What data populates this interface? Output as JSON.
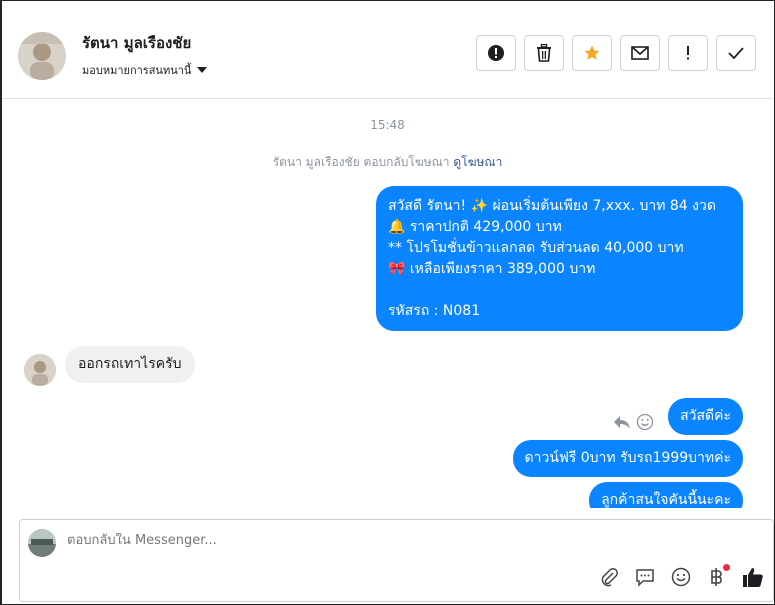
{
  "header": {
    "contact_name": "รัตนา มูลเรืองชัย",
    "assign_label": "มอบหมายการสนทนานี้",
    "actions": [
      "spam-icon",
      "trash-icon",
      "star-icon",
      "mail-icon",
      "exclamation-icon",
      "check-icon"
    ]
  },
  "thread": {
    "time": "15:48",
    "reply_note": "รัตนา มูลเรืองชัย ตอบกลับโฆษณา",
    "reply_note_link": "ดูโฆษณา",
    "promo": {
      "line1": "สวัสดี รัตนา! ✨  ผ่อนเริ่มต้นเพียง 7,xxx. บาท 84 งวด",
      "line2": "🔔 ราคาปกติ 429,000 บาท",
      "line3": "** โปรโมชั่นข้าวแลกลด รับส่วนลด 40,000 บาท",
      "line4": "🎀  เหลือเพียงราคา 389,000 บาท",
      "line5": " รหัสรถ : N081"
    },
    "incoming": "ออกรถเทาไรครับ",
    "outgoing": [
      "สวัสดีค่ะ",
      "ดาวน์ฟรี 0บาท รับรถ1999บาทค่ะ",
      "ลูกค้าสนใจคันนี้นะคะ"
    ]
  },
  "composer": {
    "placeholder": "ตอบกลับใน Messenger...",
    "tools": [
      "attach-icon",
      "saved-replies-icon",
      "emoji-icon",
      "baht-icon",
      "like-icon"
    ]
  },
  "colors": {
    "accent": "#0a84ff",
    "star": "#f5a623",
    "badge": "#f02849"
  }
}
